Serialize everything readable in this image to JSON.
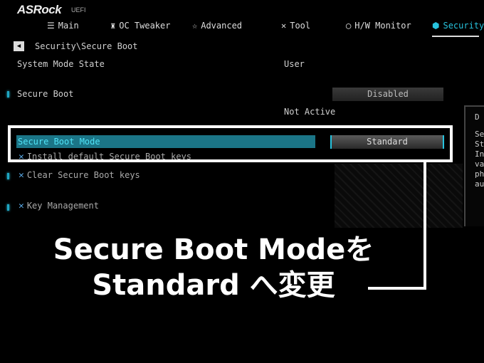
{
  "header": {
    "logo": "ASRock",
    "logo_sub": "UEFI"
  },
  "tabs": [
    {
      "label": "Main",
      "icon": "list-icon"
    },
    {
      "label": "OC Tweaker",
      "icon": "rocket-icon"
    },
    {
      "label": "Advanced",
      "icon": "star-icon"
    },
    {
      "label": "Tool",
      "icon": "tools-icon"
    },
    {
      "label": "H/W Monitor",
      "icon": "monitor-icon"
    },
    {
      "label": "Security",
      "icon": "shield-icon",
      "active": true
    }
  ],
  "breadcrumb": "Security\\Secure Boot",
  "rows": {
    "system_mode_label": "System Mode State",
    "system_mode_value": "User",
    "secure_boot_label": "Secure Boot",
    "secure_boot_value": "Disabled",
    "secure_boot_status": "Not Active",
    "mode_label": "Secure Boot Mode",
    "mode_value": "Standard",
    "install_keys": "Install default Secure Boot keys",
    "clear_keys": "Clear Secure Boot keys",
    "key_management": "Key Management"
  },
  "side_panel": {
    "title": "D",
    "lines": [
      "Sec",
      "St",
      "In",
      "va",
      "ph",
      "au"
    ]
  },
  "caption": {
    "line1": "Secure Boot Modeを",
    "line2": "Standard へ変更"
  },
  "colors": {
    "accent": "#27c3de",
    "selected_row": "#1b7587"
  }
}
